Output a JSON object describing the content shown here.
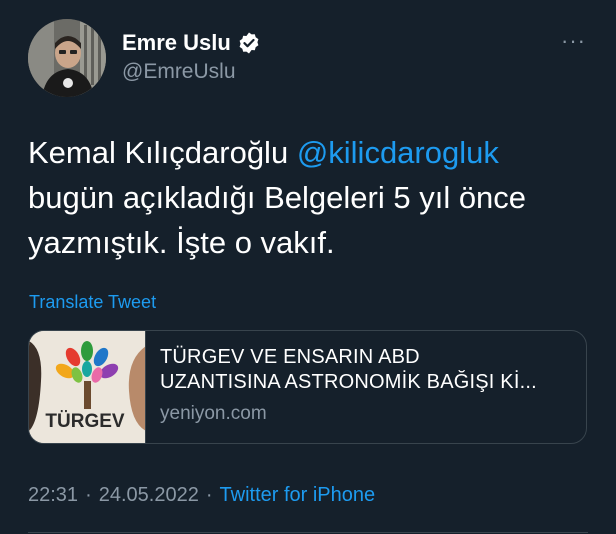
{
  "user": {
    "display_name": "Emre Uslu",
    "handle": "@EmreUslu",
    "verified": true
  },
  "more_label": "···",
  "tweet": {
    "text_before": "Kemal Kılıçdaroğlu ",
    "mention": "@kilicdarogluk",
    "text_after": " bugün açıkladığı Belgeleri 5 yıl önce yazmıştık. İşte o vakıf."
  },
  "translate_label": "Translate Tweet",
  "card": {
    "logo_text": "TÜRGEV",
    "title_line1": "TÜRGEV VE ENSARIN ABD",
    "title_line2": "UZANTISINA ASTRONOMİK BAĞIŞI Kİ...",
    "domain": "yeniyon.com"
  },
  "meta": {
    "time": "22:31",
    "sep1": "·",
    "date": "24.05.2022",
    "sep2": "·",
    "source": "Twitter for iPhone"
  },
  "colors": {
    "background": "#15202b",
    "accent": "#1d9bf0",
    "secondary_text": "#8b98a5",
    "border": "#38444d"
  }
}
